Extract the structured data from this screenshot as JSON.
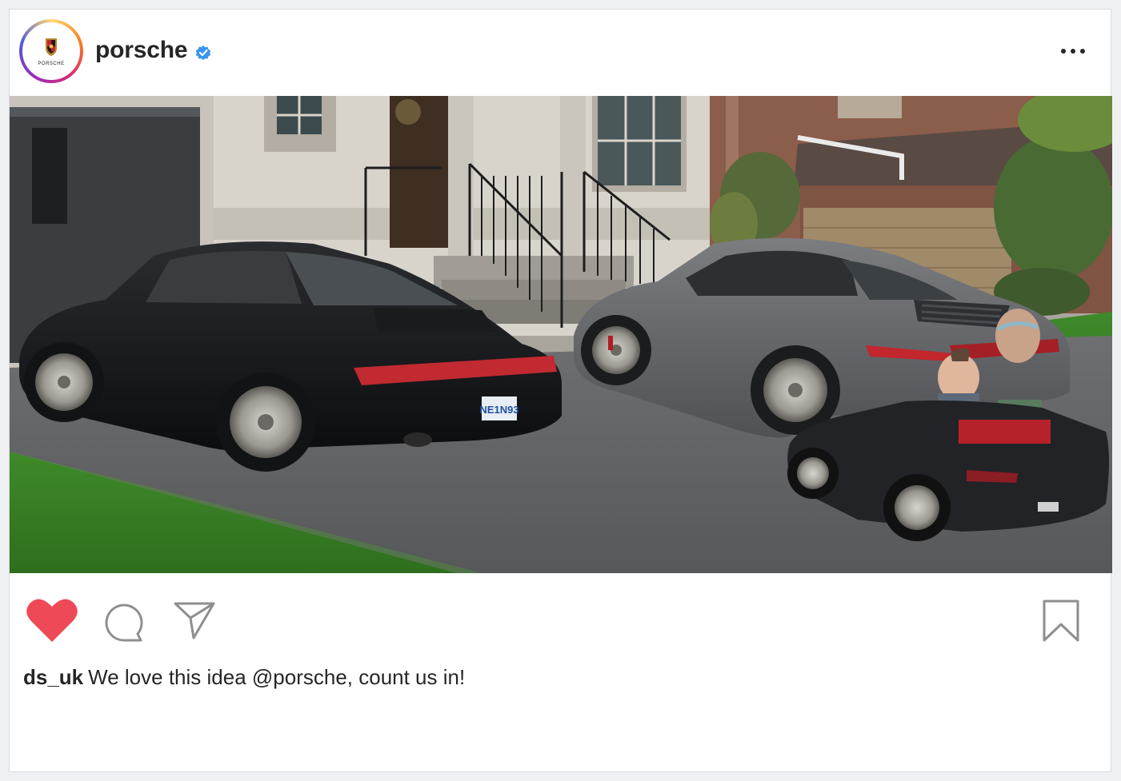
{
  "account": {
    "username": "porsche",
    "verified": true,
    "avatar_icon": "porsche-crest-icon",
    "avatar_wordmark": "PORSCHE"
  },
  "header": {
    "more_icon": "more-options-icon"
  },
  "photo": {
    "license_plate": "NE1N93"
  },
  "actions": {
    "liked": true,
    "like_color": "#ed4956",
    "icons": [
      "heart-icon",
      "comment-icon",
      "share-icon",
      "bookmark-icon"
    ]
  },
  "comment": {
    "author": "ds_uk",
    "text": "We love this idea @porsche, count us in!"
  },
  "colors": {
    "verified_blue": "#3897f0",
    "text": "#262626",
    "border": "#dbdbdb"
  }
}
